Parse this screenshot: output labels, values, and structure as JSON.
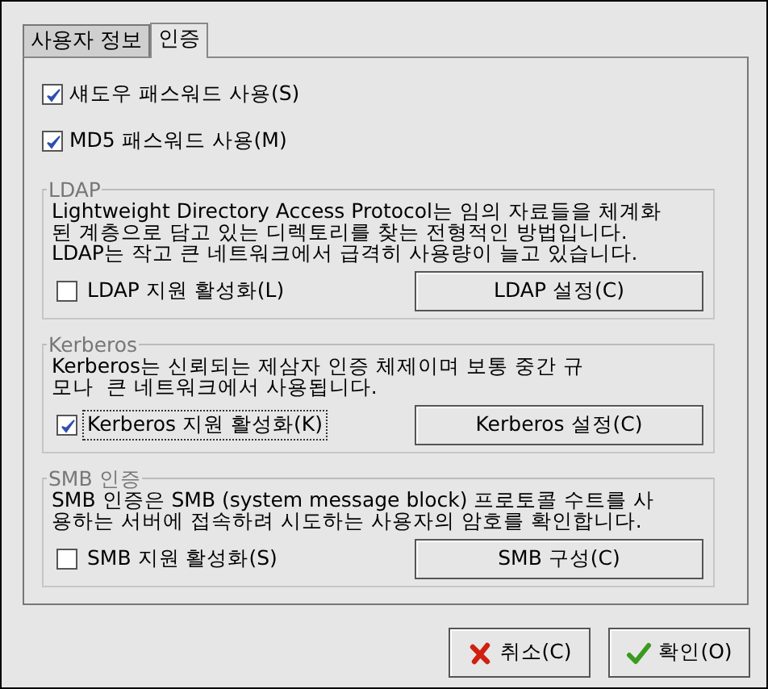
{
  "tabs": [
    {
      "label": "사용자 정보",
      "selected": false
    },
    {
      "label": "인증",
      "selected": true
    }
  ],
  "options": [
    {
      "label": "섀도우 패스워드 사용(S)",
      "checked": true
    },
    {
      "label": "MD5 패스워드 사용(M)",
      "checked": true
    }
  ],
  "groups": [
    {
      "title": "LDAP",
      "description": "Lightweight Directory Access Protocol는 임의 자료들을 체계화\n된 계층으로 담고 있는 디렉토리를 찾는 전형적인 방법입니다.\nLDAP는 작고 큰 네트워크에서 급격히 사용량이 늘고 있습니다.",
      "checkbox": {
        "label": "LDAP 지원 활성화(L)",
        "checked": false,
        "focused": false
      },
      "button": "LDAP 설정(C)"
    },
    {
      "title": "Kerberos",
      "description": "Kerberos는 신뢰되는 제삼자 인증 체제이며 보통 중간 규\n모나  큰 네트워크에서 사용됩니다.",
      "checkbox": {
        "label": "Kerberos 지원 활성화(K)",
        "checked": true,
        "focused": true
      },
      "button": "Kerberos 설정(C)"
    },
    {
      "title": "SMB 인증",
      "description": "SMB 인증은 SMB (system message block) 프로토콜 수트를 사\n용하는 서버에 접속하려 시도하는 사용자의 암호를 확인합니다.",
      "checkbox": {
        "label": "SMB 지원 활성화(S)",
        "checked": false,
        "focused": false
      },
      "button": "SMB 구성(C)"
    }
  ],
  "buttons": [
    {
      "kind": "cancel",
      "label": "취소(C)"
    },
    {
      "kind": "ok",
      "label": "확인(O)"
    }
  ]
}
